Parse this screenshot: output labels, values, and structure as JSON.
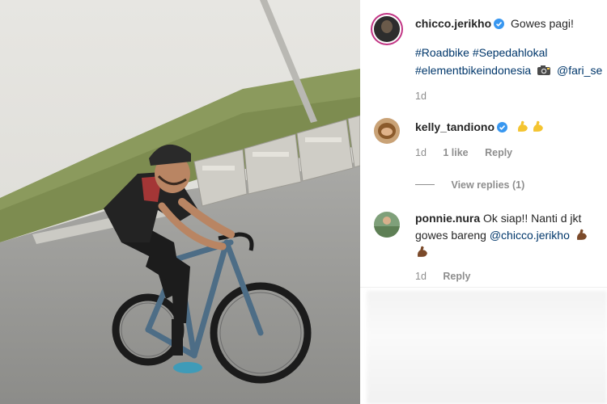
{
  "post": {
    "author": "chicco.jerikho",
    "caption": "Gowes pagi!",
    "hashtags": [
      "#Roadbike",
      "#Sepedahlokal",
      "#elementbikeindonesia"
    ],
    "camera_icon": "camera-flash-icon",
    "mention": "@fari_se",
    "time": "1d"
  },
  "comments": [
    {
      "user": "kelly_tandiono",
      "verified": true,
      "text": "",
      "emoji": "flexed-biceps-icon x2",
      "time": "1d",
      "likes": "1 like",
      "reply": "Reply",
      "view_replies": "View replies (1)"
    },
    {
      "user": "ponnie.nura",
      "verified": false,
      "text_line1": "Ok siap!! Nanti d jkt",
      "text_line2": "gowes bareng",
      "mention": "@chicco.jerikho",
      "emoji": "flexed-biceps-dark-icon x2",
      "time": "1d",
      "reply": "Reply"
    }
  ],
  "colors": {
    "verified": "#3897f0",
    "link": "#00376b",
    "meta": "#8e8e8e",
    "text": "#262626"
  }
}
